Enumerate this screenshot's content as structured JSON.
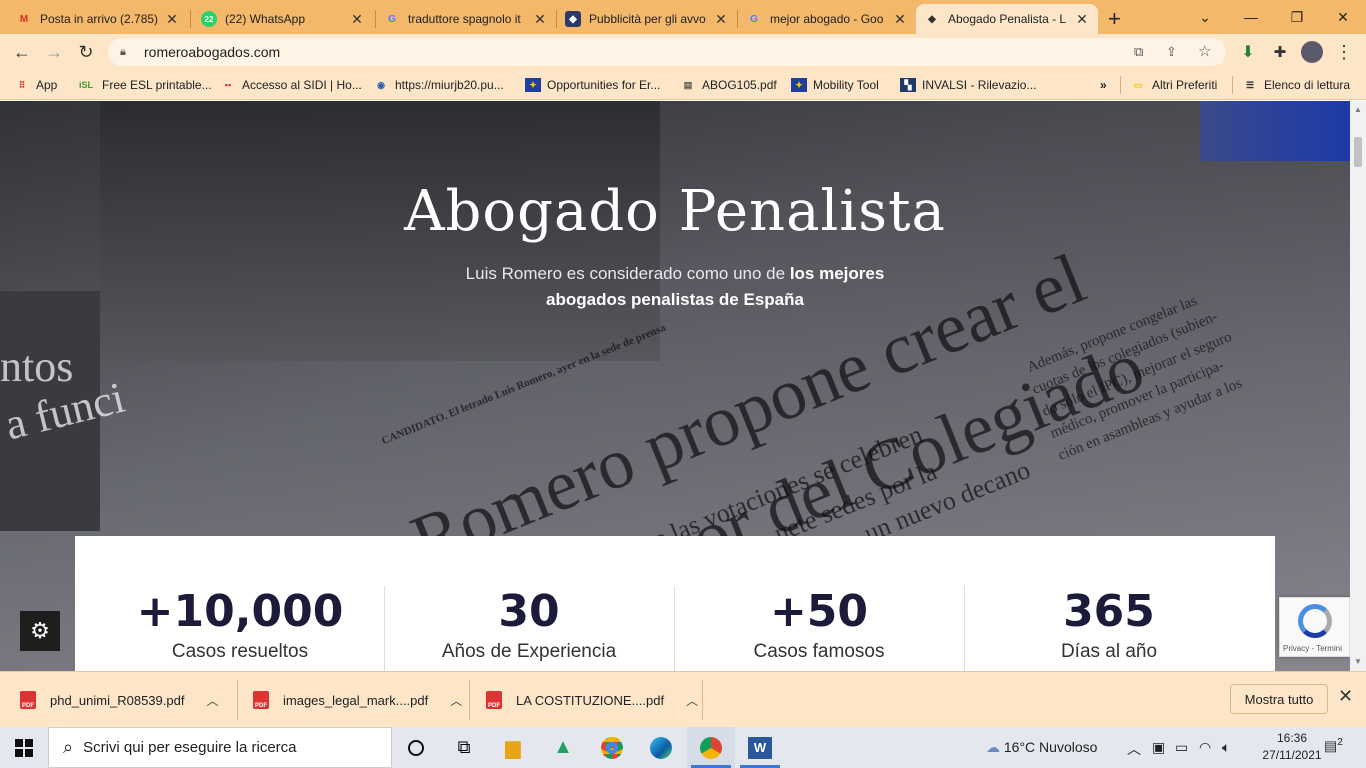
{
  "tabs": [
    {
      "title": "Posta in arrivo (2.785)",
      "icon": "gmail-icon"
    },
    {
      "title": "(22) WhatsApp",
      "icon": "whatsapp-icon",
      "badge": "22"
    },
    {
      "title": "traduttore spagnolo it",
      "icon": "google-icon"
    },
    {
      "title": "Pubblicità per gli avvo",
      "icon": "shield-icon"
    },
    {
      "title": "mejor abogado - Goo",
      "icon": "google-icon"
    },
    {
      "title": "Abogado Penalista - L",
      "icon": "romero-icon",
      "active": true
    }
  ],
  "address": {
    "url": "romeroabogados.com"
  },
  "bookmarks": [
    {
      "label": "App"
    },
    {
      "label": "Free ESL printable..."
    },
    {
      "label": "Accesso al SIDI | Ho..."
    },
    {
      "label": "https://miurjb20.pu..."
    },
    {
      "label": "Opportunities for Er..."
    },
    {
      "label": "ABOG105.pdf"
    },
    {
      "label": "Mobility Tool"
    },
    {
      "label": "INVALSI - Rilevazio..."
    }
  ],
  "bookmarks_extra": {
    "overflow": "»",
    "other": "Altri Preferiti",
    "reading": "Elenco di lettura"
  },
  "hero": {
    "title": "Abogado Penalista",
    "subtitle_plain": "Luis Romero es considerado como uno de ",
    "subtitle_bold_1": "los mejores",
    "subtitle_bold_2": "abogados penalistas de España"
  },
  "newspaper": {
    "line1": "Romero propone crear el",
    "line2": "Defensor del Colegiado",
    "line3": "se las votaciones se celebren",
    "line4": "nete sedes por la",
    "line5": "un nuevo decano",
    "line6": "CANDIDATO. El letrado Luis Romero, ayer en la sede de prensa",
    "col1": "Además, propone congelar las",
    "col2": "cuotas de los colegiados (subien-",
    "col3": "do sólo el IPC), mejorar el seguro",
    "col4": "médico, promover la participa-",
    "col5": "ción en asambleas y ayudar a los",
    "left1": "ntos",
    "left2": "a funci"
  },
  "stats": [
    {
      "value": "+10,000",
      "label": "Casos resueltos"
    },
    {
      "value": "30",
      "label": "Años de Experiencia"
    },
    {
      "value": "+50",
      "label": "Casos famosos"
    },
    {
      "value": "365",
      "label": "Días al año"
    }
  ],
  "recaptcha": {
    "text": "Privacy - Termini"
  },
  "downloads": [
    {
      "name": "phd_unimi_R08539.pdf"
    },
    {
      "name": "images_legal_mark....pdf"
    },
    {
      "name": "LA COSTITUZIONE....pdf"
    }
  ],
  "downloads_bar": {
    "show_all": "Mostra tutto"
  },
  "taskbar": {
    "search_placeholder": "Scrivi qui per eseguire la ricerca",
    "weather": "16°C  Nuvoloso",
    "time": "16:36",
    "date": "27/11/2021",
    "notifications": "2"
  },
  "colors": {
    "tabstrip": "#f4b86a",
    "toolbar": "#fde6c8",
    "stat_number": "#1c1c3a"
  }
}
